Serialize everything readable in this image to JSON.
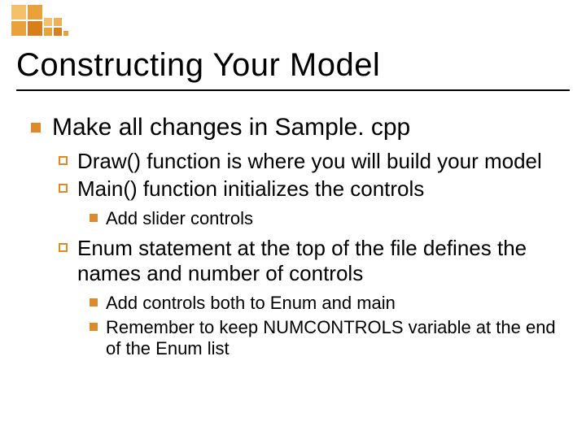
{
  "title": "Constructing Your Model",
  "lvl1": {
    "text": "Make all changes in Sample. cpp"
  },
  "lvl2": [
    {
      "lead": "Draw()",
      "rest": " function is where you will build your model"
    },
    {
      "lead": "Main()",
      "rest": " function initializes the controls"
    },
    {
      "lead": "Enum",
      "rest": " statement at the top of the file defines the names and number of controls"
    }
  ],
  "lvl3_group1": [
    "Add slider controls"
  ],
  "lvl3_group2": [
    "Add controls both to Enum and main",
    "Remember to keep NUMCONTROLS variable at the end of the Enum list"
  ]
}
